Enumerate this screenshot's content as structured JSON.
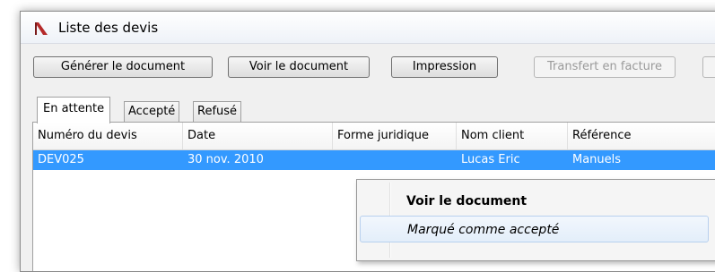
{
  "window": {
    "title": "Liste des devis",
    "icon": "app-logo-icon"
  },
  "toolbar": {
    "generate_label": "Générer le document",
    "view_label": "Voir le document",
    "print_label": "Impression",
    "transfer_label": "Transfert en facture"
  },
  "tabs": [
    {
      "label": "En attente",
      "active": true
    },
    {
      "label": "Accepté",
      "active": false
    },
    {
      "label": "Refusé",
      "active": false
    }
  ],
  "table": {
    "headers": [
      "Numéro du devis",
      "Date",
      "Forme juridique",
      "Nom client",
      "Référence"
    ],
    "rows": [
      {
        "numero": "DEV025",
        "date": "30 nov. 2010",
        "forme": "",
        "client": "Lucas Eric",
        "reference": "Manuels"
      }
    ]
  },
  "context_menu": {
    "items": [
      {
        "label": "Voir le document"
      },
      {
        "label": "Marqué comme accepté"
      }
    ]
  },
  "colors": {
    "selection": "#3399ff",
    "logo": "#b52a2a"
  }
}
